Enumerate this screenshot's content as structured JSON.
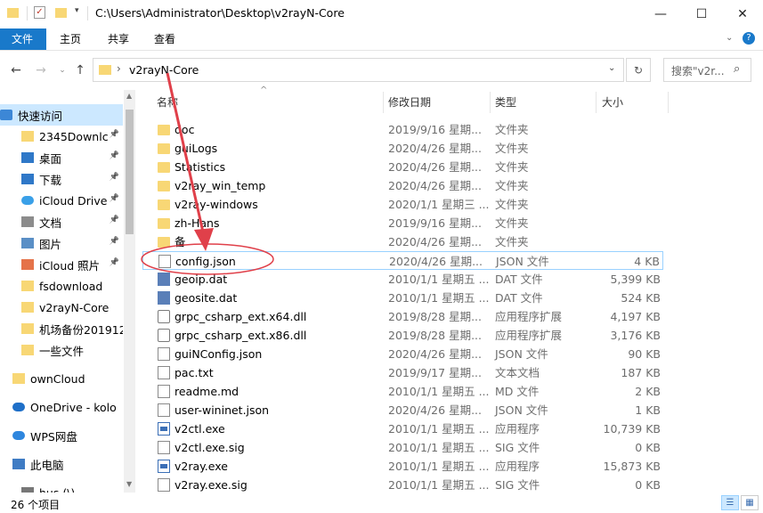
{
  "window": {
    "path": "C:\\Users\\Administrator\\Desktop\\v2rayN-Core",
    "minimize": "—",
    "maximize": "☐",
    "close": "✕"
  },
  "ribbon": {
    "tabs": [
      "文件",
      "主页",
      "共享",
      "查看"
    ]
  },
  "address": {
    "crumb": "v2rayN-Core",
    "search_placeholder": "搜索\"v2r..."
  },
  "sidebar": {
    "items": [
      {
        "label": "快速访问",
        "icon": "star-icon"
      },
      {
        "label": "2345Downlc",
        "icon": "folder-icon",
        "pinned": true
      },
      {
        "label": "桌面",
        "icon": "desktop-icon",
        "pinned": true
      },
      {
        "label": "下载",
        "icon": "download-icon",
        "pinned": true
      },
      {
        "label": "iCloud Drive",
        "icon": "cloud-icon",
        "pinned": true
      },
      {
        "label": "文档",
        "icon": "document-icon",
        "pinned": true
      },
      {
        "label": "图片",
        "icon": "picture-icon",
        "pinned": true
      },
      {
        "label": "iCloud 照片",
        "icon": "photos-icon",
        "pinned": true
      },
      {
        "label": "fsdownload",
        "icon": "folder-icon"
      },
      {
        "label": "v2rayN-Core",
        "icon": "folder-icon"
      },
      {
        "label": "机场备份201912",
        "icon": "folder-icon"
      },
      {
        "label": "一些文件",
        "icon": "folder-icon"
      },
      {
        "label": "ownCloud",
        "icon": "folder-icon"
      },
      {
        "label": "OneDrive - kolo",
        "icon": "onedrive-icon"
      },
      {
        "label": "WPS网盘",
        "icon": "wps-icon"
      },
      {
        "label": "此电脑",
        "icon": "computer-icon"
      },
      {
        "label": "hus (\\)",
        "icon": "drive-icon"
      }
    ]
  },
  "columns": {
    "name": "名称",
    "date": "修改日期",
    "type": "类型",
    "size": "大小"
  },
  "files": [
    {
      "name": "doc",
      "date": "2019/9/16 星期...",
      "type": "文件夹",
      "size": "",
      "kind": "folder"
    },
    {
      "name": "guiLogs",
      "date": "2020/4/26 星期...",
      "type": "文件夹",
      "size": "",
      "kind": "folder"
    },
    {
      "name": "Statistics",
      "date": "2020/4/26 星期...",
      "type": "文件夹",
      "size": "",
      "kind": "folder"
    },
    {
      "name": "v2ray_win_temp",
      "date": "2020/4/26 星期...",
      "type": "文件夹",
      "size": "",
      "kind": "folder"
    },
    {
      "name": "v2ray-windows",
      "date": "2020/1/1 星期三 ...",
      "type": "文件夹",
      "size": "",
      "kind": "folder"
    },
    {
      "name": "zh-Hans",
      "date": "2019/9/16 星期...",
      "type": "文件夹",
      "size": "",
      "kind": "folder"
    },
    {
      "name": "备",
      "date": "2020/4/26 星期...",
      "type": "文件夹",
      "size": "",
      "kind": "folder"
    },
    {
      "name": "config.json",
      "date": "2020/4/26 星期...",
      "type": "JSON 文件",
      "size": "4 KB",
      "kind": "file",
      "selected": true
    },
    {
      "name": "geoip.dat",
      "date": "2010/1/1 星期五 ...",
      "type": "DAT 文件",
      "size": "5,399 KB",
      "kind": "dat"
    },
    {
      "name": "geosite.dat",
      "date": "2010/1/1 星期五 ...",
      "type": "DAT 文件",
      "size": "524 KB",
      "kind": "dat"
    },
    {
      "name": "grpc_csharp_ext.x64.dll",
      "date": "2019/8/28 星期...",
      "type": "应用程序扩展",
      "size": "4,197 KB",
      "kind": "dll"
    },
    {
      "name": "grpc_csharp_ext.x86.dll",
      "date": "2019/8/28 星期...",
      "type": "应用程序扩展",
      "size": "3,176 KB",
      "kind": "dll"
    },
    {
      "name": "guiNConfig.json",
      "date": "2020/4/26 星期...",
      "type": "JSON 文件",
      "size": "90 KB",
      "kind": "file"
    },
    {
      "name": "pac.txt",
      "date": "2019/9/17 星期...",
      "type": "文本文档",
      "size": "187 KB",
      "kind": "file"
    },
    {
      "name": "readme.md",
      "date": "2010/1/1 星期五 ...",
      "type": "MD 文件",
      "size": "2 KB",
      "kind": "file"
    },
    {
      "name": "user-wininet.json",
      "date": "2020/4/26 星期...",
      "type": "JSON 文件",
      "size": "1 KB",
      "kind": "file"
    },
    {
      "name": "v2ctl.exe",
      "date": "2010/1/1 星期五 ...",
      "type": "应用程序",
      "size": "10,739 KB",
      "kind": "exe"
    },
    {
      "name": "v2ctl.exe.sig",
      "date": "2010/1/1 星期五 ...",
      "type": "SIG 文件",
      "size": "0 KB",
      "kind": "file"
    },
    {
      "name": "v2ray.exe",
      "date": "2010/1/1 星期五 ...",
      "type": "应用程序",
      "size": "15,873 KB",
      "kind": "exe"
    },
    {
      "name": "v2ray.exe.sig",
      "date": "2010/1/1 星期五 ...",
      "type": "SIG 文件",
      "size": "0 KB",
      "kind": "file"
    }
  ],
  "status": {
    "count": "26 个项目"
  },
  "colors": {
    "accent": "#1979ca",
    "selection_border": "#99d1ff",
    "annotation": "#e0404a"
  }
}
